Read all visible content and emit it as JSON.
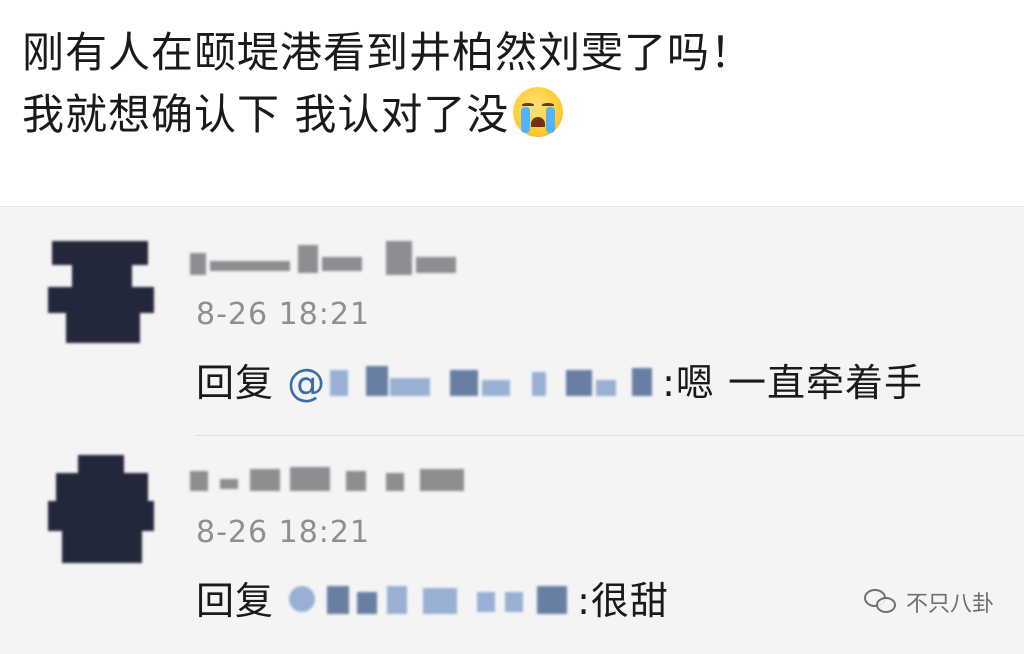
{
  "post": {
    "line1": "刚有人在颐堤港看到井柏然刘雯了吗！",
    "line2": "我就想确认下 我认对了没",
    "emoji_icon": "loudly-crying-face-icon"
  },
  "comments": [
    {
      "time": "8-26 18:21",
      "reply_prefix": "回复",
      "at": "@",
      "separator": ":",
      "message": "嗯 一直牵着手"
    },
    {
      "time": "8-26 18:21",
      "reply_prefix": "回复",
      "at": "",
      "separator": ":",
      "message": "很甜"
    }
  ],
  "watermark": {
    "icon": "wechat-icon",
    "text": "不只八卦"
  },
  "colors": {
    "comment_bg": "#f4f4f5",
    "mention_blue": "#3a6ea8",
    "time_gray": "#8e8e93"
  }
}
